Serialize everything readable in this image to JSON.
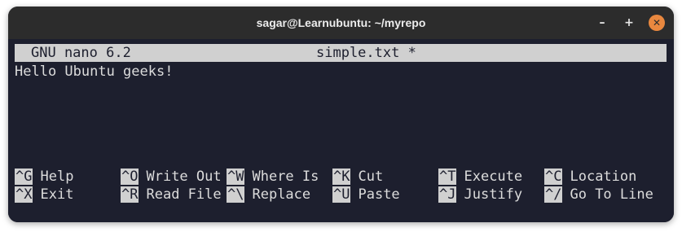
{
  "window": {
    "title": "sagar@Learnubuntu: ~/myrepo"
  },
  "controls": {
    "minimize": "–",
    "maximize": "+",
    "close": "✕"
  },
  "nano": {
    "version": "GNU nano 6.2",
    "filename": "simple.txt *",
    "content": "Hello Ubuntu geeks!"
  },
  "shortcuts": [
    {
      "key": "^G",
      "label": "Help"
    },
    {
      "key": "^O",
      "label": "Write Out"
    },
    {
      "key": "^W",
      "label": "Where Is"
    },
    {
      "key": "^K",
      "label": "Cut"
    },
    {
      "key": "^T",
      "label": "Execute"
    },
    {
      "key": "^C",
      "label": "Location"
    },
    {
      "key": "^X",
      "label": "Exit"
    },
    {
      "key": "^R",
      "label": "Read File"
    },
    {
      "key": "^\\",
      "label": "Replace"
    },
    {
      "key": "^U",
      "label": "Paste"
    },
    {
      "key": "^J",
      "label": "Justify"
    },
    {
      "key": "^/",
      "label": "Go To Line"
    }
  ]
}
